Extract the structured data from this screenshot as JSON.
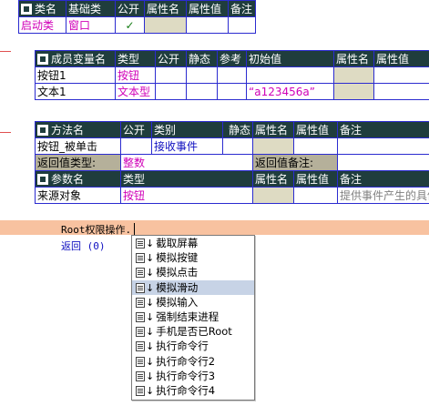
{
  "class_table": {
    "headers": [
      "类名",
      "基础类",
      "公开",
      "属性名",
      "属性值",
      "备注"
    ],
    "row": {
      "name": "启动类",
      "base": "窗口",
      "public": "✓",
      "prop_name": "",
      "prop_val": "",
      "note": ""
    }
  },
  "member_table": {
    "headers": [
      "成员变量名",
      "类型",
      "公开",
      "静态",
      "参考",
      "初始值",
      "属性名",
      "属性值"
    ],
    "rows": [
      {
        "name": "按钮1",
        "type": "按钮",
        "init": ""
      },
      {
        "name": "文本1",
        "type": "文本型",
        "init": "“a123456a”"
      }
    ]
  },
  "method_table": {
    "headers": [
      "方法名",
      "公开",
      "类别",
      "静态",
      "属性名",
      "属性值",
      "备注"
    ],
    "row": {
      "name": "按钮_被单击",
      "category": "接收事件"
    },
    "return_type_label": "返回值类型:",
    "return_type": "整数",
    "return_note_label": "返回值备注:",
    "param_headers": [
      "参数名",
      "类型",
      "属性名",
      "属性值",
      "备注"
    ],
    "param_row": {
      "name": "来源对象",
      "type": "按钮",
      "note": "提供事件产生的具体"
    }
  },
  "code": {
    "line1": "Root权限操作.",
    "line2": "返回 (0)"
  },
  "popup": {
    "items": [
      "截取屏幕",
      "模拟按键",
      "模拟点击",
      "模拟滑动",
      "模拟输入",
      "强制结束进程",
      "手机是否已Root",
      "执行命令行",
      "执行命令行2",
      "执行命令行3",
      "执行命令行4"
    ],
    "selected": "模拟滑动"
  }
}
